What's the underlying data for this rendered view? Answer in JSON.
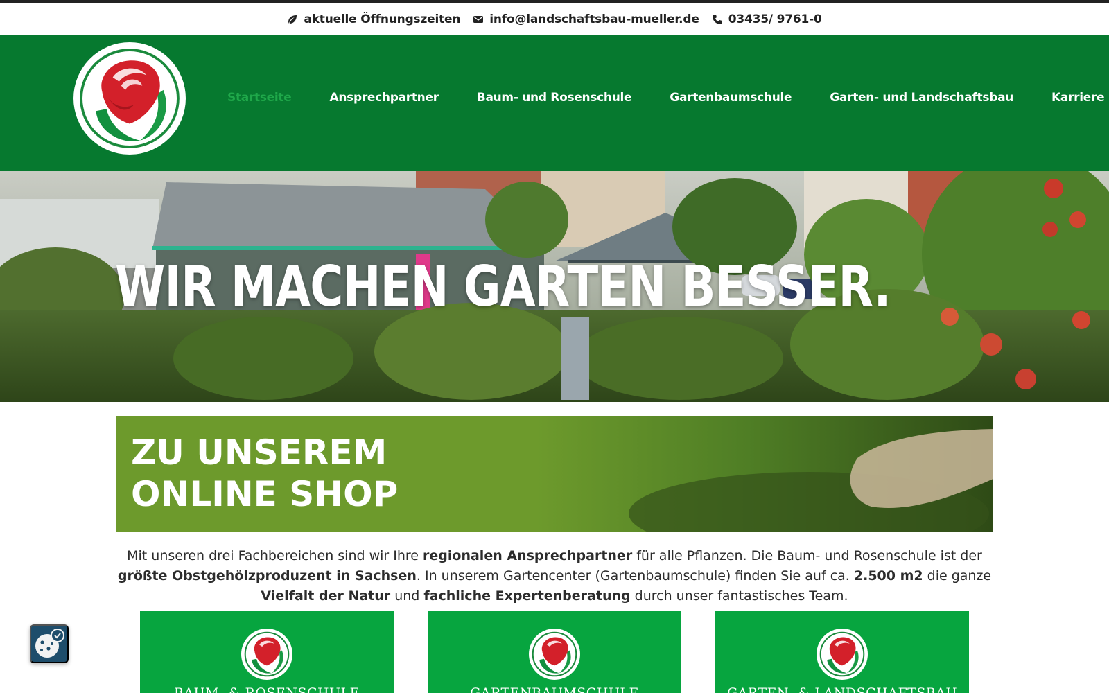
{
  "topbar": {
    "hours": "aktuelle Öffnungszeiten",
    "email": "info@landschaftsbau-mueller.de",
    "phone": "03435/ 9761-0"
  },
  "nav": {
    "items": [
      {
        "label": "Startseite",
        "active": true
      },
      {
        "label": "Ansprechpartner"
      },
      {
        "label": "Baum- und Rosenschule"
      },
      {
        "label": "Gartenbaumschule"
      },
      {
        "label": "Garten- und Landschaftsbau"
      },
      {
        "label": "Karriere"
      }
    ]
  },
  "hero": {
    "title": "WIR MACHEN GARTEN BESSER."
  },
  "shop_banner": {
    "line1": "ZU UNSEREM",
    "line2": "ONLINE SHOP"
  },
  "intro": {
    "t1": "Mit unseren drei Fachbereichen sind wir Ihre ",
    "b1": "regionalen Ansprechpartner",
    "t2": " für alle Pflanzen. Die Baum- und Rosenschule ist der ",
    "b2": "größte Obstgehölzproduzent in Sachsen",
    "t3": ". In unserem Gartencenter (Gartenbaumschule) finden Sie auf ca. ",
    "b3": "2.500 m2",
    "t4": " die ganze ",
    "b4": "Vielfalt der Natur",
    "t5": " und ",
    "b5": "fachliche Expertenberatung",
    "t6": " durch unser fantastisches Team."
  },
  "cards": [
    {
      "title": "BAUM- & ROSENSCHULE"
    },
    {
      "title": "GARTENBAUMSCHULE"
    },
    {
      "title": "GARTEN- & LANDSCHAFTSBAU"
    }
  ],
  "colors": {
    "header_green": "#06792f",
    "active_nav": "#1fa84a",
    "card_green": "#07a53f",
    "banner_green": "#6d9a2c",
    "cookie_blue": "#1e4d6b"
  },
  "icons": {
    "hours": "leaf-icon",
    "email": "envelope-icon",
    "phone": "phone-icon",
    "cookie": "cookie-settings-icon"
  }
}
